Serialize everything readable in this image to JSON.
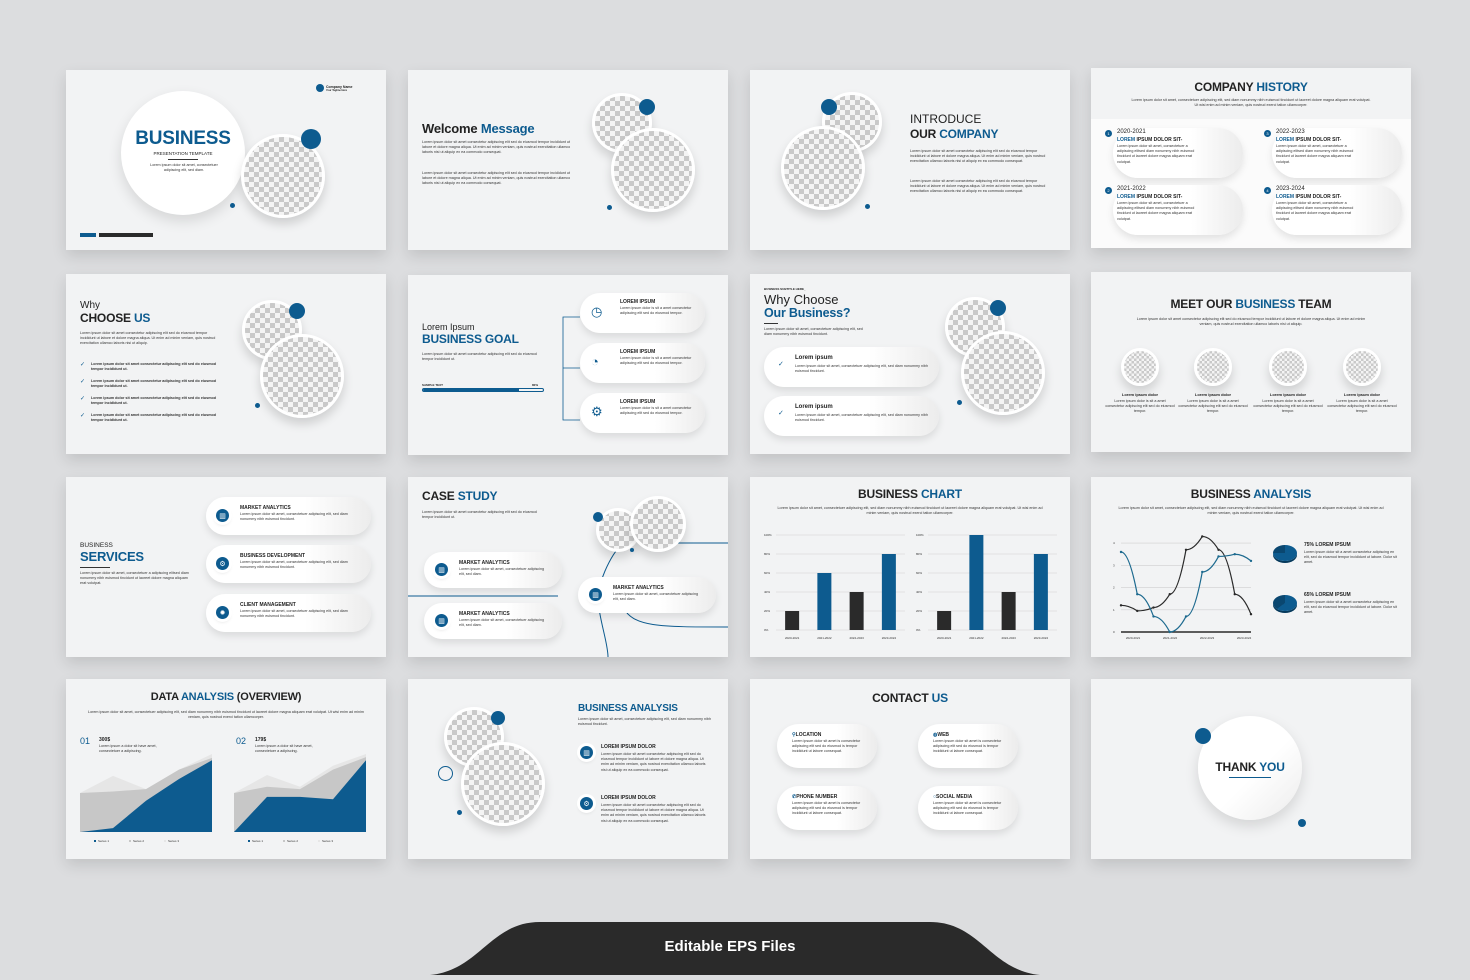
{
  "colors": {
    "accent": "#0d5b8f",
    "dark": "#2a2a2a",
    "background": "#dcdddf"
  },
  "lorem": {
    "l1": "Lorem ipsum dolor sit amet consectetur adipiscing elit sed do eiusmod tempor incididunt ut labore et dolore magna aliqua. Ut enim ad minim veniam, quis nostrud exercitation ullamco laboris nisi ut aliquip ex ea commodo consequat.",
    "l2": "Lorem ipsum dolor sit amet, consectetuer adipiscing elit, sed diam nonummy nibh euismod tincidunt ut laoreet dolore magna aliquam erat volutpat. Ut wisi enim ad minim veniam, quis nostrud exerci tation ullamcorper.",
    "l3": "Lorem ipsum dolor sit amet, consectetuer adipiscing elit, sed diam nonummy nibh euismod tincidunt.",
    "l4": "Lorem ipsum dolor sit amet consectetur adipiscing elit sed do eiusmod tempor incididunt ut.",
    "l5": "Lorem ipsum dolor is sit a amet consectetur adipiscing elit sed do eiusmod tempor.",
    "l6": "Lorem ipsum dolor sit amet, consectetuer a adipiscing elitsed diam nonummy nibh euismod tincidunt ut laoreet dolore magna aliquam erat volutpat.",
    "l7": "Lorem ipsum dolor sit amet, consectetuer adipiscing elit, sed diam.",
    "l8": "Lorem ipsum dolor sit a amet consectetur adipiscing en elit, sed do eiusmod tempor incididunt ut labore. Dolor sit amet.",
    "l9": "Lorem ipsum a dolor sit have amet, consectetuer a adipiscing.",
    "l10": "Lorem ipsum dolor sit amet is consectetur adipiscing elit sed do eiusmod is tempor incididunt ut labore consequat.",
    "l11": "Lorem ipsum dolor sit amet, consectetur adipiscing elit, sed diam.",
    "l12": "Lorem ipsum dolor sit amet consectetur adipiscing elit sed do eiusmod tempor incididunt ut labore et dolore magna aliqua. Ut enim ad minim veniam, quis nostrud exercitation ullamco laboris nisi ut aliquip."
  },
  "s1": {
    "title": "BUSINESS",
    "subtitle": "PRESENTATION TEMPLATE",
    "text": "Lorem ipsum dolor sit amet, consectetuer adipiscing elit, sed diam.",
    "company": "Company Name",
    "tagline": "Your Tagline Here"
  },
  "s2": {
    "t1": "Welcome ",
    "t2": "Message"
  },
  "s3": {
    "t1": "INTRODUCE",
    "t2": "OUR ",
    "t3": "COMPANY"
  },
  "s4": {
    "t1": "COMPANY ",
    "t2": "HISTORY",
    "items": [
      {
        "n": "1",
        "year": "2020-2021",
        "h1": "LOREM ",
        "h2": "IPSUM DOLOR SIT-"
      },
      {
        "n": "2",
        "year": "2021-2022",
        "h1": "LOREM ",
        "h2": "IPSUM DOLOR SIT-"
      },
      {
        "n": "3",
        "year": "2022-2023",
        "h1": "LOREM ",
        "h2": "IPSUM DOLOR SIT-"
      },
      {
        "n": "4",
        "year": "2023-2024",
        "h1": "LOREM ",
        "h2": "IPSUM DOLOR SIT-"
      }
    ]
  },
  "s5": {
    "t1": "Why",
    "t2": "CHOOSE ",
    "t3": "US"
  },
  "s6": {
    "t1": "Lorem Ipsum",
    "t2": "BUSINESS GOAL",
    "bar_label": "SAMPLE TEXT",
    "bar_value_label": "80%",
    "bar_value": 80,
    "items": [
      "LOREM IPSUM",
      "LOREM IPSUM",
      "LOREM IPSUM"
    ],
    "icons": [
      "clock-icon",
      "pie-chart-icon",
      "gear-icon"
    ]
  },
  "s7": {
    "subtitle": "BUSINESS SUBTITLE HERE_",
    "t1": "Why Choose",
    "t2": "Our Business?",
    "items": [
      "Lorem ipsum",
      "Lorem ipsum"
    ]
  },
  "s8": {
    "t1": "MEET OUR ",
    "t2": "BUSINESS",
    "t3": " TEAM",
    "members": [
      "Lorem ipsum dolor",
      "Lorem ipsum dolor",
      "Lorem ipsum dolor",
      "Lorem ipsum dolor"
    ]
  },
  "s9": {
    "t1": "BUSINESS",
    "t2": "SERVICES",
    "items": [
      "MARKET ANALYTICS",
      "BUSINESS DEVELOPMENT",
      "CLIENT MANAGEMENT"
    ],
    "icons": [
      "chart-icon",
      "gear-icon",
      "lightbulb-icon"
    ]
  },
  "s10": {
    "t1": "CASE ",
    "t2": "STUDY",
    "items": [
      "MARKET ANALYTICS",
      "MARKET ANALYTICS",
      "MARKET ANALYTICS"
    ]
  },
  "s11": {
    "t1": "BUSINESS ",
    "t2": "CHART"
  },
  "s12": {
    "t1": "BUSINESS ",
    "t2": "ANALYSIS",
    "items": [
      "75% LOREM IPSUM",
      "65% LOREM IPSUM"
    ]
  },
  "s13": {
    "t1": "DATA ",
    "t2": "ANALYSIS",
    "t3": " (OVERVIEW)",
    "blocks": [
      {
        "n": "01",
        "value": "300$"
      },
      {
        "n": "02",
        "value": "179$"
      }
    ]
  },
  "s14": {
    "title": "BUSINESS ANALYSIS",
    "items": [
      "LOREM IPSUM DOLOR",
      "LOREM IPSUM DOLOR"
    ]
  },
  "s15": {
    "t1": "CONTACT ",
    "t2": "US",
    "items": [
      {
        "label": "LOCATION",
        "icon": "location-pin-icon"
      },
      {
        "label": "WEB",
        "icon": "globe-icon"
      },
      {
        "label": "PHONE NUMBER",
        "icon": "phone-icon"
      },
      {
        "label": "SOCIAL MEDIA",
        "icon": "social-icon"
      }
    ]
  },
  "s16": {
    "t1": "THANK ",
    "t2": "YOU"
  },
  "banner": {
    "text": "Editable EPS Files"
  },
  "chart_data": [
    {
      "type": "bar",
      "yticks": [
        "0%",
        "20%",
        "40%",
        "60%",
        "80%",
        "100%"
      ],
      "ylim": [
        0,
        100
      ],
      "categories": [
        "2020-2021",
        "2021-2022",
        "2022-2023",
        "2023-2024"
      ],
      "values": [
        20,
        60,
        40,
        80
      ],
      "bar_colors": [
        "#2a2a2a",
        "#0d5b8f",
        "#2a2a2a",
        "#0d5b8f"
      ]
    },
    {
      "type": "bar",
      "yticks": [
        "0%",
        "20%",
        "40%",
        "60%",
        "80%",
        "100%"
      ],
      "ylim": [
        0,
        100
      ],
      "categories": [
        "2020-2021",
        "2021-2022",
        "2022-2023",
        "2023-2024"
      ],
      "values": [
        20,
        100,
        40,
        80
      ],
      "bar_colors": [
        "#2a2a2a",
        "#0d5b8f",
        "#2a2a2a",
        "#0d5b8f"
      ]
    },
    {
      "type": "line",
      "yticks": [
        "0",
        "1",
        "2",
        "3",
        "4"
      ],
      "ylim": [
        0,
        4.5
      ],
      "categories": [
        "2020-2021",
        "2021-2022",
        "2022-2023",
        "2023-2024"
      ],
      "x": [
        0,
        0.5,
        1,
        1.5,
        2,
        2.5,
        3,
        3.5,
        4
      ],
      "series": [
        {
          "color": "#2a2a2a",
          "values": [
            1.2,
            0.95,
            1.1,
            1.7,
            3.7,
            4.3,
            3.7,
            1.7,
            0.8
          ]
        },
        {
          "color": "#1d6a8f",
          "values": [
            3.6,
            1.7,
            0.7,
            0,
            0.7,
            2.7,
            3.4,
            3.5,
            3.2
          ]
        }
      ]
    },
    {
      "type": "area",
      "legend": [
        "Series 1",
        "Series 2",
        "Series 3"
      ],
      "legend_position": "bottom",
      "ylim": [
        0,
        100
      ],
      "series": [
        {
          "color": "#0d5b8f",
          "values": [
            0,
            5,
            40,
            68,
            92
          ]
        },
        {
          "color": "#c7c7c7",
          "values": [
            50,
            52,
            55,
            80,
            95
          ]
        },
        {
          "color": "#e6e6e6",
          "values": [
            50,
            72,
            55,
            80,
            100
          ]
        }
      ]
    },
    {
      "type": "area",
      "legend": [
        "Series 1",
        "Series 2",
        "Series 3"
      ],
      "legend_position": "bottom",
      "ylim": [
        0,
        100
      ],
      "series": [
        {
          "color": "#0d5b8f",
          "values": [
            0,
            45,
            45,
            42,
            92
          ]
        },
        {
          "color": "#c7c7c7",
          "values": [
            50,
            58,
            55,
            80,
            96
          ]
        },
        {
          "color": "#e6e6e6",
          "values": [
            50,
            73,
            58,
            85,
            100
          ]
        }
      ]
    }
  ]
}
